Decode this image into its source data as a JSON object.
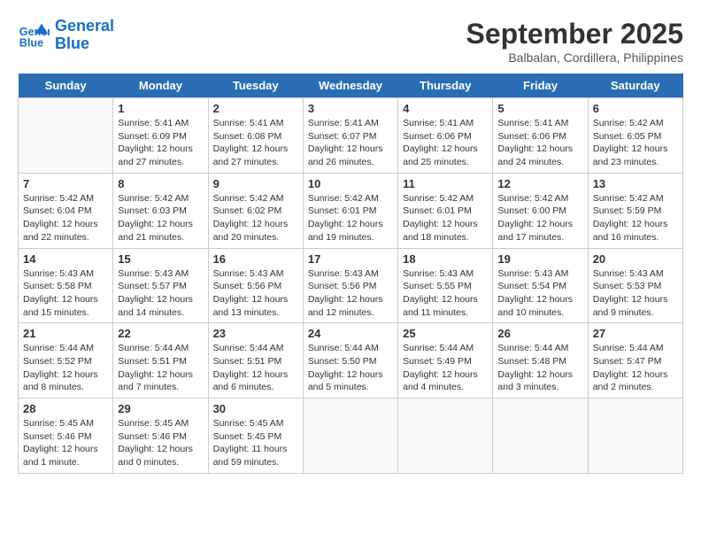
{
  "logo": {
    "line1": "General",
    "line2": "Blue"
  },
  "title": "September 2025",
  "location": "Balbalan, Cordillera, Philippines",
  "days": [
    "Sunday",
    "Monday",
    "Tuesday",
    "Wednesday",
    "Thursday",
    "Friday",
    "Saturday"
  ],
  "weeks": [
    [
      {
        "date": "",
        "info": ""
      },
      {
        "date": "1",
        "info": "Sunrise: 5:41 AM\nSunset: 6:09 PM\nDaylight: 12 hours\nand 27 minutes."
      },
      {
        "date": "2",
        "info": "Sunrise: 5:41 AM\nSunset: 6:08 PM\nDaylight: 12 hours\nand 27 minutes."
      },
      {
        "date": "3",
        "info": "Sunrise: 5:41 AM\nSunset: 6:07 PM\nDaylight: 12 hours\nand 26 minutes."
      },
      {
        "date": "4",
        "info": "Sunrise: 5:41 AM\nSunset: 6:06 PM\nDaylight: 12 hours\nand 25 minutes."
      },
      {
        "date": "5",
        "info": "Sunrise: 5:41 AM\nSunset: 6:06 PM\nDaylight: 12 hours\nand 24 minutes."
      },
      {
        "date": "6",
        "info": "Sunrise: 5:42 AM\nSunset: 6:05 PM\nDaylight: 12 hours\nand 23 minutes."
      }
    ],
    [
      {
        "date": "7",
        "info": "Sunrise: 5:42 AM\nSunset: 6:04 PM\nDaylight: 12 hours\nand 22 minutes."
      },
      {
        "date": "8",
        "info": "Sunrise: 5:42 AM\nSunset: 6:03 PM\nDaylight: 12 hours\nand 21 minutes."
      },
      {
        "date": "9",
        "info": "Sunrise: 5:42 AM\nSunset: 6:02 PM\nDaylight: 12 hours\nand 20 minutes."
      },
      {
        "date": "10",
        "info": "Sunrise: 5:42 AM\nSunset: 6:01 PM\nDaylight: 12 hours\nand 19 minutes."
      },
      {
        "date": "11",
        "info": "Sunrise: 5:42 AM\nSunset: 6:01 PM\nDaylight: 12 hours\nand 18 minutes."
      },
      {
        "date": "12",
        "info": "Sunrise: 5:42 AM\nSunset: 6:00 PM\nDaylight: 12 hours\nand 17 minutes."
      },
      {
        "date": "13",
        "info": "Sunrise: 5:42 AM\nSunset: 5:59 PM\nDaylight: 12 hours\nand 16 minutes."
      }
    ],
    [
      {
        "date": "14",
        "info": "Sunrise: 5:43 AM\nSunset: 5:58 PM\nDaylight: 12 hours\nand 15 minutes."
      },
      {
        "date": "15",
        "info": "Sunrise: 5:43 AM\nSunset: 5:57 PM\nDaylight: 12 hours\nand 14 minutes."
      },
      {
        "date": "16",
        "info": "Sunrise: 5:43 AM\nSunset: 5:56 PM\nDaylight: 12 hours\nand 13 minutes."
      },
      {
        "date": "17",
        "info": "Sunrise: 5:43 AM\nSunset: 5:56 PM\nDaylight: 12 hours\nand 12 minutes."
      },
      {
        "date": "18",
        "info": "Sunrise: 5:43 AM\nSunset: 5:55 PM\nDaylight: 12 hours\nand 11 minutes."
      },
      {
        "date": "19",
        "info": "Sunrise: 5:43 AM\nSunset: 5:54 PM\nDaylight: 12 hours\nand 10 minutes."
      },
      {
        "date": "20",
        "info": "Sunrise: 5:43 AM\nSunset: 5:53 PM\nDaylight: 12 hours\nand 9 minutes."
      }
    ],
    [
      {
        "date": "21",
        "info": "Sunrise: 5:44 AM\nSunset: 5:52 PM\nDaylight: 12 hours\nand 8 minutes."
      },
      {
        "date": "22",
        "info": "Sunrise: 5:44 AM\nSunset: 5:51 PM\nDaylight: 12 hours\nand 7 minutes."
      },
      {
        "date": "23",
        "info": "Sunrise: 5:44 AM\nSunset: 5:51 PM\nDaylight: 12 hours\nand 6 minutes."
      },
      {
        "date": "24",
        "info": "Sunrise: 5:44 AM\nSunset: 5:50 PM\nDaylight: 12 hours\nand 5 minutes."
      },
      {
        "date": "25",
        "info": "Sunrise: 5:44 AM\nSunset: 5:49 PM\nDaylight: 12 hours\nand 4 minutes."
      },
      {
        "date": "26",
        "info": "Sunrise: 5:44 AM\nSunset: 5:48 PM\nDaylight: 12 hours\nand 3 minutes."
      },
      {
        "date": "27",
        "info": "Sunrise: 5:44 AM\nSunset: 5:47 PM\nDaylight: 12 hours\nand 2 minutes."
      }
    ],
    [
      {
        "date": "28",
        "info": "Sunrise: 5:45 AM\nSunset: 5:46 PM\nDaylight: 12 hours\nand 1 minute."
      },
      {
        "date": "29",
        "info": "Sunrise: 5:45 AM\nSunset: 5:46 PM\nDaylight: 12 hours\nand 0 minutes."
      },
      {
        "date": "30",
        "info": "Sunrise: 5:45 AM\nSunset: 5:45 PM\nDaylight: 11 hours\nand 59 minutes."
      },
      {
        "date": "",
        "info": ""
      },
      {
        "date": "",
        "info": ""
      },
      {
        "date": "",
        "info": ""
      },
      {
        "date": "",
        "info": ""
      }
    ]
  ]
}
